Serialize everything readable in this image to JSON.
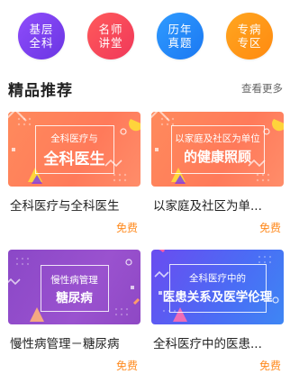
{
  "categories": [
    {
      "label": "基层全科",
      "color": "#7c40f0"
    },
    {
      "label": "名师讲堂",
      "color": "#f6465a"
    },
    {
      "label": "历年真题",
      "color": "#2589f8"
    },
    {
      "label": "专病专区",
      "color": "#ff9818"
    }
  ],
  "section": {
    "title": "精品推荐",
    "more_label": "查看更多"
  },
  "courses": [
    {
      "banner_line1": "全科医疗与",
      "banner_line2": "全科医生",
      "title": "全科医疗与全科医生",
      "price": "免费",
      "theme": "orange"
    },
    {
      "banner_line1": "以家庭及社区为单位",
      "banner_line2": "的健康照顾",
      "title": "以家庭及社区为单...",
      "price": "免费",
      "theme": "orange"
    },
    {
      "banner_line1": "慢性病管理",
      "banner_line2": "糖尿病",
      "title": "慢性病管理－糖尿病",
      "price": "免费",
      "theme": "purple"
    },
    {
      "banner_line1": "全科医疗中的",
      "banner_line2": "医患关系及医学伦理",
      "title": "全科医疗中的医患...",
      "price": "免费",
      "theme": "blue"
    }
  ],
  "colors": {
    "price": "#ff8a1e",
    "orange_banner": "#ff7d5a",
    "purple_banner": "#9450cc",
    "blue_banner": "#4f6cf3"
  }
}
